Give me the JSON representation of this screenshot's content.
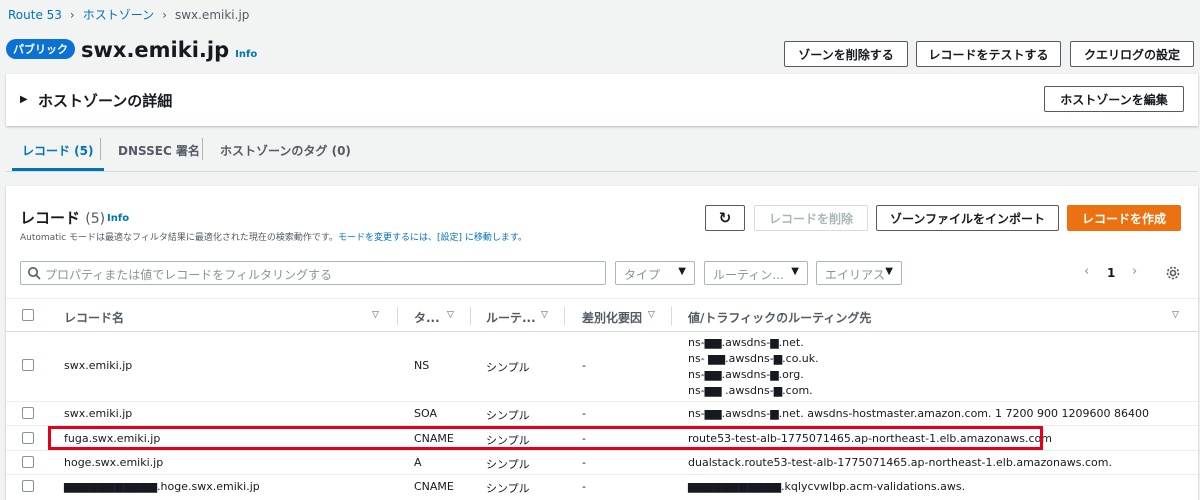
{
  "breadcrumb": [
    "Route 53",
    "ホストゾーン",
    "swx.emiki.jp"
  ],
  "header": {
    "badge": "パブリック",
    "title": "swx.emiki.jp",
    "info": "Info",
    "buttons": [
      "ゾーンを削除する",
      "レコードをテストする",
      "クエリログの設定"
    ]
  },
  "details": {
    "label": "ホストゾーンの詳細",
    "edit_button": "ホストゾーンを編集"
  },
  "tabs": [
    "レコード (5)",
    "DNSSEC 署名",
    "ホストゾーンのタグ (0)"
  ],
  "records": {
    "title": "レコード",
    "count": "(5)",
    "info": "Info",
    "description_prefix": "Automatic モードは最適なフィルタ結果に最適化された現在の検索動作です。",
    "description_link": "モードを変更するには、[設定] に移動します。",
    "actions": {
      "refresh": "↻",
      "delete": "レコードを削除",
      "import": "ゾーンファイルをインポート",
      "create": "レコードを作成"
    },
    "search_placeholder": "プロパティまたは値でレコードをフィルタリングする",
    "filters": [
      "タイプ",
      "ルーティン...",
      "エイリアス"
    ],
    "page": "1",
    "columns": [
      "レコード名",
      "タ...",
      "ルーテ...",
      "差別化要因",
      "値/トラフィックのルーティング先"
    ],
    "rows": [
      {
        "name": "swx.emiki.jp",
        "type": "NS",
        "routing": "シンプル",
        "diff": "-",
        "values": [
          "ns-▆▆.awsdns-▆.net.",
          "ns- ▆▆.awsdns-▆.co.uk.",
          "ns-▆▆.awsdns-▆.org.",
          "ns-▆▆ .awsdns-▆.com."
        ]
      },
      {
        "name": "swx.emiki.jp",
        "type": "SOA",
        "routing": "シンプル",
        "diff": "-",
        "values": [
          "ns-▆▆.awsdns-▆.net. awsdns-hostmaster.amazon.com. 1 7200 900 1209600 86400"
        ]
      },
      {
        "name": "fuga.swx.emiki.jp",
        "type": "CNAME",
        "routing": "シンプル",
        "diff": "-",
        "values": [
          "route53-test-alb-1775071465.ap-northeast-1.elb.amazonaws.com"
        ]
      },
      {
        "name": "hoge.swx.emiki.jp",
        "type": "A",
        "routing": "シンプル",
        "diff": "-",
        "values": [
          "dualstack.route53-test-alb-1775071465.ap-northeast-1.elb.amazonaws.com."
        ]
      },
      {
        "name": "▆▆▆▆▆▆▆▆▆▆▆.hoge.swx.emiki.jp",
        "type": "CNAME",
        "routing": "シンプル",
        "diff": "-",
        "values": [
          "▆▆▆▆▆▆▆▆▆▆▆.kqlycvwlbp.acm-validations.aws."
        ]
      }
    ]
  },
  "colors": {
    "accent": "#0073bb",
    "primary_button": "#ec7211",
    "highlight": "#e3001b"
  }
}
